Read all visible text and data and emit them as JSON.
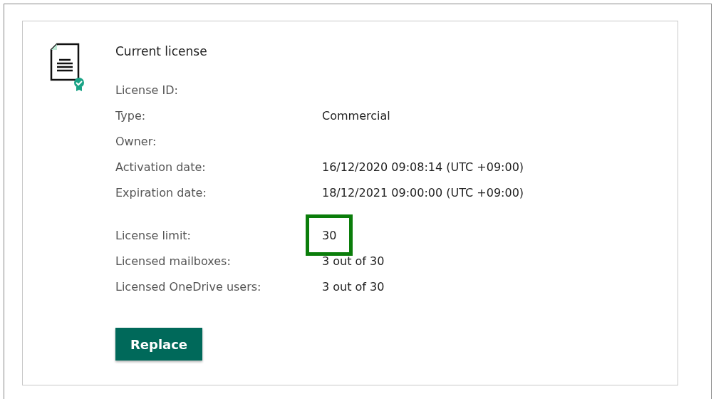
{
  "title": "Current license",
  "groups": [
    {
      "rows": [
        {
          "label": "License ID:",
          "value": "",
          "highlighted": false
        },
        {
          "label": "Type:",
          "value": "Commercial",
          "highlighted": false
        },
        {
          "label": "Owner:",
          "value": "",
          "highlighted": false
        },
        {
          "label": "Activation date:",
          "value": "16/12/2020 09:08:14 (UTC +09:00)",
          "highlighted": false
        },
        {
          "label": "Expiration date:",
          "value": "18/12/2021 09:00:00 (UTC +09:00)",
          "highlighted": false
        }
      ]
    },
    {
      "rows": [
        {
          "label": "License limit:",
          "value": "30",
          "highlighted": true
        },
        {
          "label": "Licensed mailboxes:",
          "value": "3 out of 30",
          "highlighted": false
        },
        {
          "label": "Licensed OneDrive users:",
          "value": "3 out of 30",
          "highlighted": false
        }
      ]
    }
  ],
  "button": "Replace"
}
